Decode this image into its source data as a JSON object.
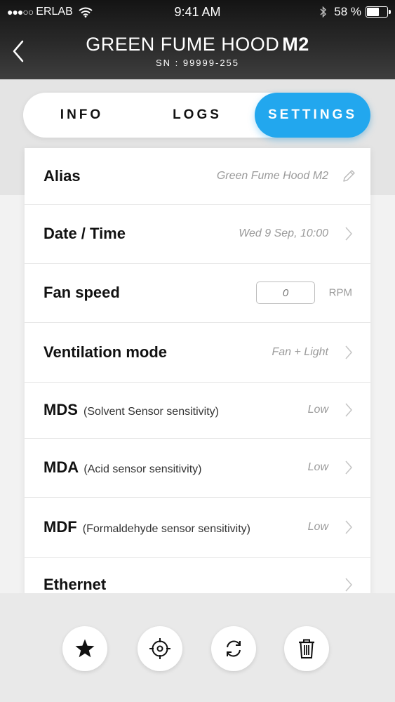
{
  "status_bar": {
    "signal_dots": "●●●○○",
    "carrier": "ERLAB",
    "time": "9:41 AM",
    "battery_percent": "58 %",
    "battery_level": 0.58
  },
  "header": {
    "title_main": "GREEN FUME HOOD",
    "title_model": "M2",
    "serial": "SN : 99999-255"
  },
  "tabs": [
    {
      "label": "INFO",
      "active": false
    },
    {
      "label": "LOGS",
      "active": false
    },
    {
      "label": "SETTINGS",
      "active": true
    }
  ],
  "settings": {
    "alias": {
      "label": "Alias",
      "value": "Green Fume Hood M2"
    },
    "datetime": {
      "label": "Date / Time",
      "value": "Wed 9 Sep, 10:00"
    },
    "fan_speed": {
      "label": "Fan speed",
      "value": "0",
      "unit": "RPM"
    },
    "ventilation": {
      "label": "Ventilation mode",
      "value": "Fan + Light"
    },
    "mds": {
      "label": "MDS",
      "sublabel": "(Solvent Sensor sensitivity)",
      "value": "Low"
    },
    "mda": {
      "label": "MDA",
      "sublabel": "(Acid sensor sensitivity)",
      "value": "Low"
    },
    "mdf": {
      "label": "MDF",
      "sublabel": "(Formaldehyde sensor sensitivity)",
      "value": "Low"
    },
    "ethernet": {
      "label": "Ethernet"
    }
  },
  "actions": [
    {
      "icon": "star-icon"
    },
    {
      "icon": "locate-icon"
    },
    {
      "icon": "refresh-icon"
    },
    {
      "icon": "trash-icon"
    }
  ],
  "colors": {
    "accent": "#22a7ee",
    "header_dark": "#1e1e1e",
    "muted_text": "#9a9a9a"
  }
}
